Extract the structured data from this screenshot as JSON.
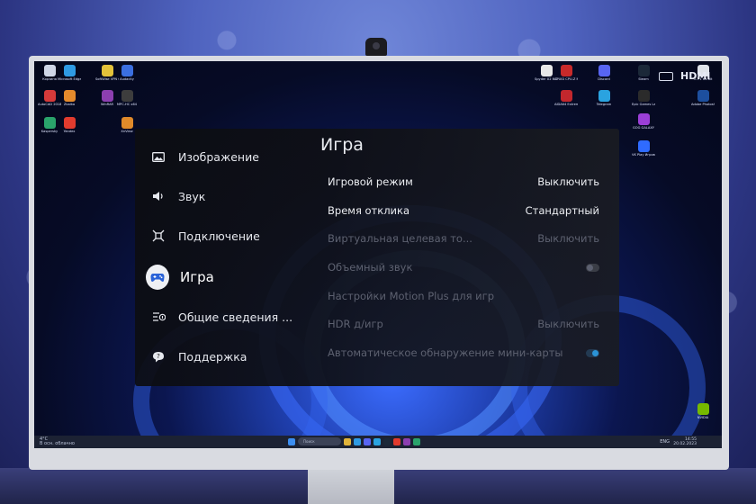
{
  "monitor": {
    "input_label": "HDMI"
  },
  "menu": {
    "sidebar": [
      {
        "label": "Изображение",
        "icon": "picture-icon",
        "active": false
      },
      {
        "label": "Звук",
        "icon": "speaker-icon",
        "active": false
      },
      {
        "label": "Подключение",
        "icon": "connection-icon",
        "active": false
      },
      {
        "label": "Игра",
        "icon": "gamepad-icon",
        "active": true
      },
      {
        "label": "Общие сведения ...",
        "icon": "info-list-icon",
        "active": false
      },
      {
        "label": "Поддержка",
        "icon": "support-icon",
        "active": false
      }
    ],
    "title": "Игра",
    "rows": [
      {
        "label": "Игровой режим",
        "value": "Выключить",
        "enabled": true
      },
      {
        "label": "Время отклика",
        "value": "Стандартный",
        "enabled": true
      },
      {
        "label": "Виртуальная целевая то...",
        "value": "Выключить",
        "enabled": false
      },
      {
        "label": "Объемный звук",
        "toggle": "off",
        "enabled": false
      },
      {
        "label": "Настройки Motion Plus для игр",
        "value": "",
        "enabled": false
      },
      {
        "label": "HDR д/игр",
        "value": "Выключить",
        "enabled": false
      },
      {
        "label": "Автоматическое обнаружение мини-карты",
        "toggle": "on",
        "enabled": false
      }
    ]
  },
  "desktop": {
    "icons": [
      {
        "label": "Корзина",
        "color": "#cfd6e6"
      },
      {
        "label": "Microsoft Edge",
        "color": "#2f9be3"
      },
      {
        "label": "AutoCAD 2018 -...",
        "color": "#d63a3a"
      },
      {
        "label": "Zbalka",
        "color": "#e58a2c"
      },
      {
        "label": "Kaspersky",
        "color": "#2aa36b"
      },
      {
        "label": "Yandex",
        "color": "#e23b2e"
      },
      {
        "label": "SoftWise VPN Cli...",
        "color": "#e4c23a"
      },
      {
        "label": "Audacity",
        "color": "#3b6fe0"
      },
      {
        "label": "WinRAR",
        "color": "#8c3fb0"
      },
      {
        "label": "MPC-HC x64",
        "color": "#3d3d3d"
      },
      {
        "label": "XnView",
        "color": "#e08a2a"
      },
      {
        "label": "Spyder X2 6.0.1",
        "color": "#e8e8e8"
      },
      {
        "label": "CPUID CPU-Z MSI",
        "color": "#c92a2a"
      },
      {
        "label": "AIDA64 Extreme",
        "color": "#c2272d"
      },
      {
        "label": "Discord",
        "color": "#5865f2"
      },
      {
        "label": "Telegram",
        "color": "#2aa3e0"
      },
      {
        "label": "Steam",
        "color": "#1b2838"
      },
      {
        "label": "Epic Games Launcher",
        "color": "#2b2b2b"
      },
      {
        "label": "GOG GALAXY",
        "color": "#9b3fd6"
      },
      {
        "label": "VK Play Игровой...",
        "color": "#2f6bff"
      },
      {
        "label": "5.7.1 64-bit",
        "color": "#dfe3ea"
      },
      {
        "label": "Adobe Photosh...",
        "color": "#1d4f9e"
      },
      {
        "label": "NVIDIA",
        "color": "#76b900"
      }
    ],
    "taskbar": {
      "weather_temp": "4°C",
      "weather_desc": "В осн. облачно",
      "search_placeholder": "Поиск",
      "lang": "ENG",
      "time": "14:55",
      "date": "20.02.2023"
    }
  }
}
